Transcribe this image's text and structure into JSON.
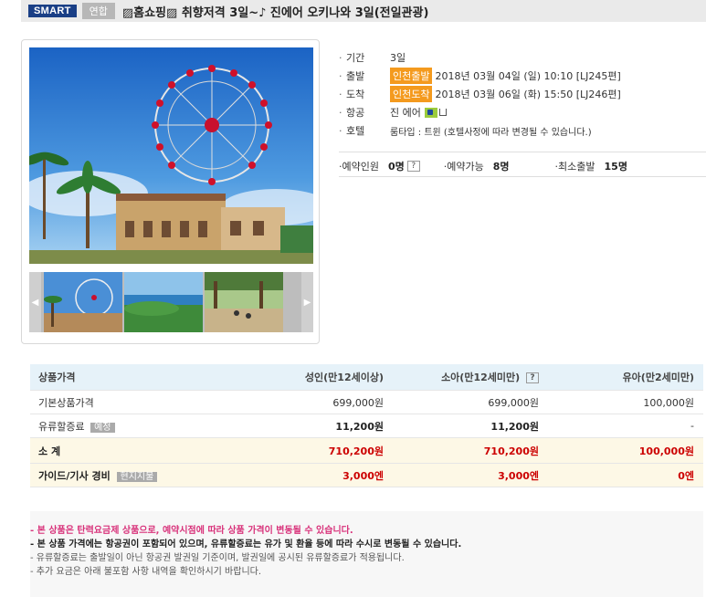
{
  "title_bar": {
    "smart_badge": "SMART",
    "link_badge": "연합",
    "title": "▨홈쇼핑▨ 취향저격 3일~♪ 진에어 오키나와 3일(전일관광)"
  },
  "info": {
    "dot": "·",
    "period": {
      "label": "기간",
      "value": "3일"
    },
    "departure": {
      "label": "출발",
      "tag": "인천출발",
      "value": "2018년 03월 04일 (일) 10:10 [LJ245편]"
    },
    "arrival": {
      "label": "도착",
      "tag": "인천도착",
      "value": "2018년 03월 06일 (화) 15:50 [LJ246편]"
    },
    "airline": {
      "label": "항공",
      "value": "진 에어"
    },
    "hotel": {
      "label": "호텔",
      "value": "룸타입 : 트윈 (호텔사정에 따라 변경될 수 있습니다.)"
    }
  },
  "booking": {
    "reserved_label": "예약인원",
    "reserved_value": "0명",
    "help_mark": "?",
    "available_label": "예약가능",
    "available_value": "8명",
    "minimum_label": "최소출발",
    "minimum_value": "15명"
  },
  "price_table": {
    "headers": [
      "상품가격",
      "성인(만12세이상)",
      "소아(만12세미만)",
      "유아(만2세미만)"
    ],
    "help_mark": "?",
    "rows": [
      {
        "label": "기본상품가격",
        "badge": "",
        "adult": "699,000원",
        "child": "699,000원",
        "infant": "100,000원"
      },
      {
        "label": "유류할증료",
        "badge": "예정",
        "adult": "11,200원",
        "child": "11,200원",
        "infant": "-"
      },
      {
        "label": "소 계",
        "badge": "",
        "adult": "710,200원",
        "child": "710,200원",
        "infant": "100,000원"
      },
      {
        "label": "가이드/기사 경비",
        "badge": "현지지불",
        "adult": "3,000엔",
        "child": "3,000엔",
        "infant": "0엔"
      }
    ]
  },
  "notes": [
    "- 본 상품은 탄력요금제 상품으로, 예약시점에 따라 상품 가격이 변동될 수 있습니다.",
    "- 본 상품 가격에는 항공권이 포함되어 있으며, 유류할증료는 유가 및 환율 등에 따라 수시로 변동될 수 있습니다.",
    "- 유류할증료는 출발일이 아닌 항공권 발권일 기준이며, 발권일에 공시된 유류할증료가 적용됩니다.",
    "- 추가 요금은 아래 불포함 사항 내역을 확인하시기 바랍니다."
  ],
  "colors": {
    "smart_badge": "#1a3f86",
    "orange_tag": "#f49a1e",
    "red_price": "#cc0000",
    "pink_note": "#d8317a",
    "table_head": "#e6f2f9",
    "sum_row": "#fdf8e6"
  },
  "icons": {
    "airline_logo": "jinair-logo-icon",
    "prev_arrow": "chevron-left-icon",
    "next_arrow": "chevron-right-icon"
  }
}
